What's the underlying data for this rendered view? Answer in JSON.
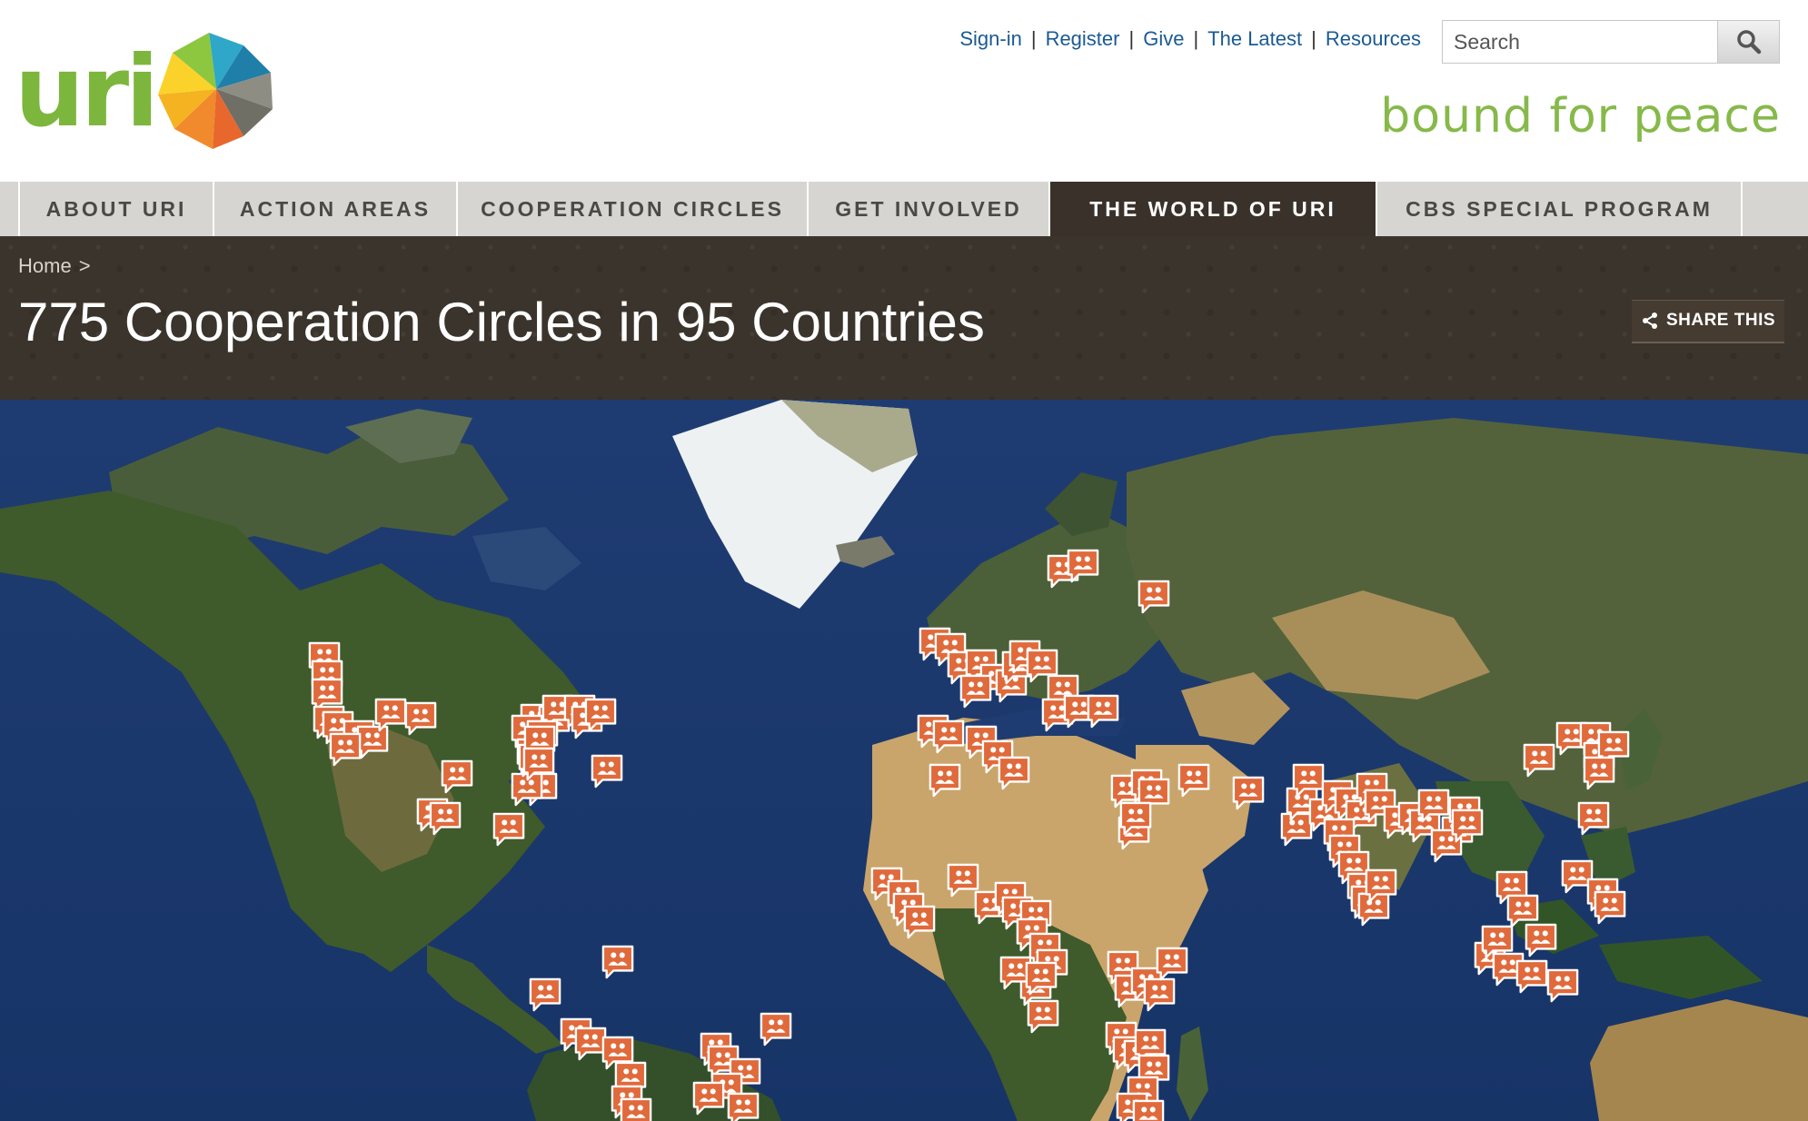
{
  "logo": {
    "text": "uri"
  },
  "util_nav": [
    {
      "label": "Sign-in"
    },
    {
      "label": "Register"
    },
    {
      "label": "Give"
    },
    {
      "label": "The Latest"
    },
    {
      "label": "Resources"
    }
  ],
  "search": {
    "placeholder": "Search"
  },
  "tagline": "bound for peace",
  "main_nav": [
    {
      "label": "ABOUT URI",
      "active": false
    },
    {
      "label": "ACTION AREAS",
      "active": false
    },
    {
      "label": "COOPERATION CIRCLES",
      "active": false
    },
    {
      "label": "GET INVOLVED",
      "active": false
    },
    {
      "label": "THE WORLD OF URI",
      "active": true
    },
    {
      "label": "CBS SPECIAL PROGRAM",
      "active": false
    }
  ],
  "breadcrumb": {
    "home": "Home",
    "separator": ">"
  },
  "page": {
    "title": "775 Cooperation Circles in 95 Countries"
  },
  "share": {
    "label": "SHARE THIS",
    "icon": "share-icon"
  },
  "map": {
    "marker_icon": "people-icon",
    "marker_color": "#e06a3b",
    "ocean_color": "#1c3a70",
    "land_color": "#3f5a2b",
    "desert_color": "#c9a56b",
    "ice_color": "#eef1f2"
  },
  "colors": {
    "link": "#1b5a93",
    "brand_green": "#7db63d",
    "nav_bg": "#d6d5d1",
    "nav_active_bg": "#3a322a",
    "title_band_bg": "#3b342c"
  }
}
